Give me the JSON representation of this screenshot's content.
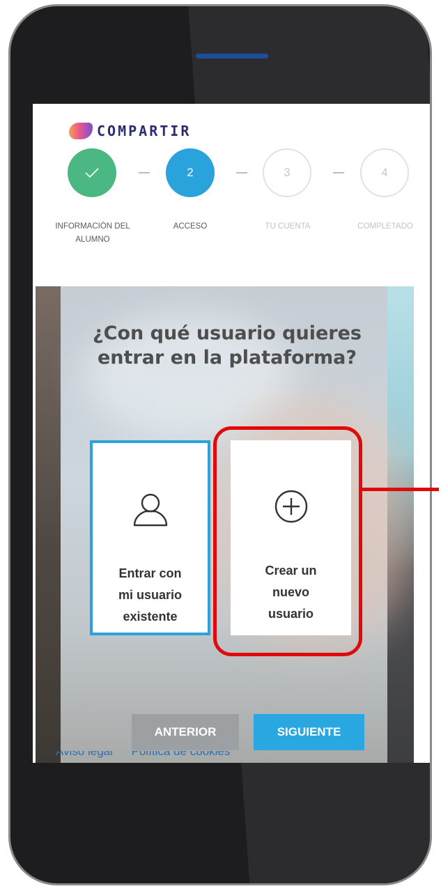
{
  "brand": {
    "logo_text": "COMPARTIR"
  },
  "stepper": {
    "steps": [
      {
        "number": "",
        "label": "INFORMACIÓN DEL\nALUMNO",
        "state": "completed"
      },
      {
        "number": "2",
        "label": "ACCESO",
        "state": "active"
      },
      {
        "number": "3",
        "label": "TU CUENTA",
        "state": "pending"
      },
      {
        "number": "4",
        "label": "COMPLETADO",
        "state": "pending"
      }
    ]
  },
  "hero": {
    "title": "¿Con qué usuario quieres entrar en la plataforma?"
  },
  "options": [
    {
      "label": "Entrar con\nmi usuario\nexistente",
      "icon": "user-icon",
      "selected": true
    },
    {
      "label": "Crear un\nnuevo\nusuario",
      "icon": "plus-circle-icon",
      "selected": false
    }
  ],
  "buttons": {
    "prev_label": "ANTERIOR",
    "next_label": "SIGUIENTE"
  },
  "footer": {
    "links": [
      "Aviso legal",
      "Política de cookies"
    ]
  },
  "colors": {
    "completed": "#4bb783",
    "active": "#2aa3dc",
    "highlight": "#e10a0a",
    "next_button": "#29a7e1",
    "prev_button": "#9da0a3"
  }
}
